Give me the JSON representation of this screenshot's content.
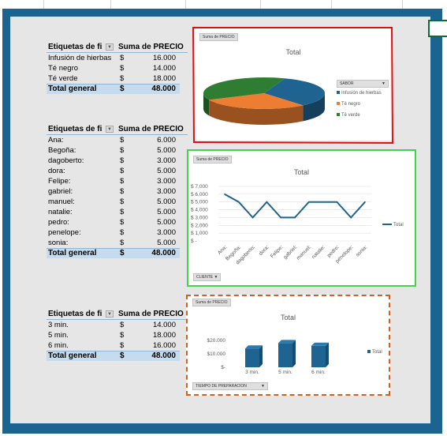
{
  "pivots": [
    {
      "header": {
        "col1": "Etiquetas de fi",
        "col2": "Suma de PRECIO"
      },
      "rows": [
        {
          "label": "Infusión de hierbas",
          "currency": "$",
          "value": "16.000"
        },
        {
          "label": "Té negro",
          "currency": "$",
          "value": "14.000"
        },
        {
          "label": "Té verde",
          "currency": "$",
          "value": "18.000"
        }
      ],
      "total": {
        "label": "Total general",
        "currency": "$",
        "value": "48.000"
      }
    },
    {
      "header": {
        "col1": "Etiquetas de fi",
        "col2": "Suma de PRECIO"
      },
      "rows": [
        {
          "label": "Ana:",
          "currency": "$",
          "value": "6.000"
        },
        {
          "label": "Begoña:",
          "currency": "$",
          "value": "5.000"
        },
        {
          "label": "dagoberto:",
          "currency": "$",
          "value": "3.000"
        },
        {
          "label": "dora:",
          "currency": "$",
          "value": "5.000"
        },
        {
          "label": "Felipe:",
          "currency": "$",
          "value": "3.000"
        },
        {
          "label": "gabriel:",
          "currency": "$",
          "value": "3.000"
        },
        {
          "label": "manuel:",
          "currency": "$",
          "value": "5.000"
        },
        {
          "label": "natalie:",
          "currency": "$",
          "value": "5.000"
        },
        {
          "label": "pedro:",
          "currency": "$",
          "value": "5.000"
        },
        {
          "label": "penelope:",
          "currency": "$",
          "value": "3.000"
        },
        {
          "label": "sonia:",
          "currency": "$",
          "value": "5.000"
        }
      ],
      "total": {
        "label": "Total general",
        "currency": "$",
        "value": "48.000"
      }
    },
    {
      "header": {
        "col1": "Etiquetas de fi",
        "col2": "Suma de PRECIO"
      },
      "rows": [
        {
          "label": "3 min.",
          "currency": "$",
          "value": "14.000"
        },
        {
          "label": "5 min.",
          "currency": "$",
          "value": "18.000"
        },
        {
          "label": "6 min.",
          "currency": "$",
          "value": "16.000"
        }
      ],
      "total": {
        "label": "Total general",
        "currency": "$",
        "value": "48.000"
      }
    }
  ],
  "chart_data": [
    {
      "type": "pie",
      "title": "Total",
      "value_field_button": "Suma de PRECIO",
      "axis_field_button": "SABOR",
      "legend_position": "right",
      "categories": [
        "Infusión de hierbas",
        "Té negro",
        "Té verde"
      ],
      "values": [
        16000,
        14000,
        18000
      ],
      "colors": [
        "#1f6391",
        "#ed7d31",
        "#2e7d32"
      ]
    },
    {
      "type": "line",
      "title": "Total",
      "value_field_button": "Suma de PRECIO",
      "axis_field_button": "CLIENTE",
      "legend_position": "right",
      "series": [
        {
          "name": "Total",
          "values": [
            6000,
            5000,
            3000,
            5000,
            3000,
            3000,
            5000,
            5000,
            5000,
            3000,
            5000
          ]
        }
      ],
      "categories": [
        "Ana:",
        "Begoña:",
        "dagoberto:",
        "dora:",
        "Felipe:",
        "gabriel:",
        "manuel:",
        "natalie:",
        "pedro:",
        "penelope:",
        "sonia:"
      ],
      "ylim": [
        0,
        7000
      ],
      "ytick_labels": [
        "$ 7,000",
        "$ 6,000",
        "$ 5,000",
        "$ 4,000",
        "$ 3,000",
        "$ 2,000",
        "$ 1,000",
        "$ -"
      ],
      "grid": true,
      "color": "#1f6391"
    },
    {
      "type": "bar",
      "title": "Total",
      "value_field_button": "Suma de PRECIO",
      "axis_field_button": "TIEMPO DE PREPARACION",
      "legend_position": "right",
      "categories": [
        "3 min.",
        "5 min.",
        "6 min."
      ],
      "series": [
        {
          "name": "Total",
          "values": [
            14000,
            18000,
            16000
          ]
        }
      ],
      "ylim": [
        0,
        20000
      ],
      "ytick_labels": [
        "$20.000",
        "$10.000",
        "$-"
      ],
      "color": "#1f6391"
    }
  ]
}
